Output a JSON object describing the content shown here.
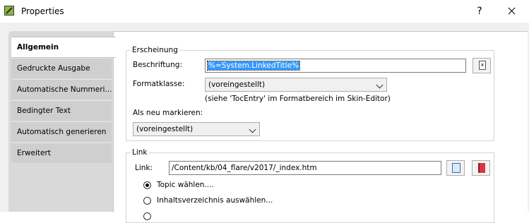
{
  "window": {
    "title": "Properties",
    "help_label": "?"
  },
  "tabs": [
    {
      "label": "Allgemein",
      "active": true
    },
    {
      "label": "Gedruckte Ausgabe"
    },
    {
      "label": "Automatische  Nummeri..."
    },
    {
      "label": "Bedingter Text"
    },
    {
      "label": "Automatisch generieren"
    },
    {
      "label": "Erweitert"
    }
  ],
  "erscheinung": {
    "legend": "Erscheinung",
    "caption_label": "Beschriftung:",
    "caption_value": "%=System.LinkedTitle%",
    "format_label": "Formatklasse:",
    "format_value": "(voreingestellt)",
    "format_hint": "(siehe 'TocEntry' im Formatbereich im Skin-Editor)",
    "mark_new_label": "Als neu markieren:",
    "mark_new_value": "(voreingestellt)"
  },
  "link": {
    "legend": "Link",
    "link_label": "Link:",
    "link_value": "/Content/kb/04_flare/v2017/_index.htm",
    "radio_topic": "Topic wählen....",
    "radio_toc": "Inhaltsverzeichnis auswählen..."
  },
  "colors": {
    "selection": "#3399ff",
    "panel": "#d9d9d9"
  }
}
